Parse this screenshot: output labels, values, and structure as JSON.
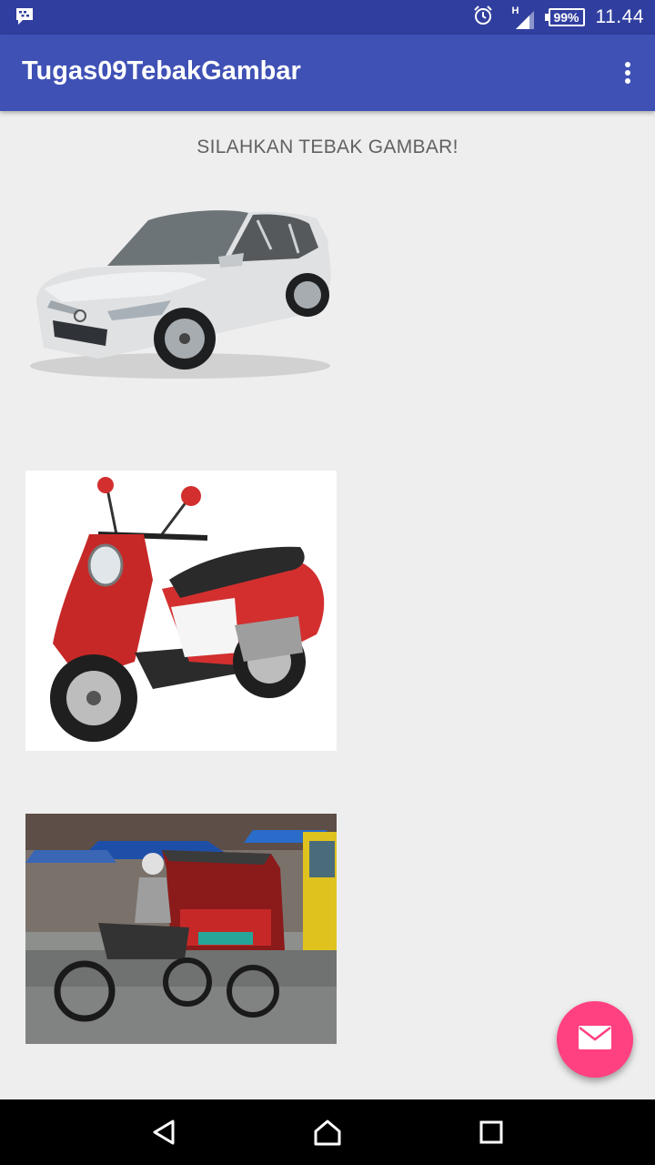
{
  "status_bar": {
    "time": "11.44",
    "battery": "99%",
    "network_label": "H",
    "icons": [
      "bbm-icon",
      "alarm-icon",
      "signal-icon",
      "battery-icon"
    ]
  },
  "app_bar": {
    "title": "Tugas09TebakGambar",
    "overflow_icon": "more-vert-icon"
  },
  "content": {
    "prompt": "SILAHKAN TEBAK GAMBAR!",
    "images": [
      "car-image",
      "scooter-image",
      "becak-image"
    ]
  },
  "fab": {
    "icon": "mail-icon"
  },
  "nav_bar": {
    "icons": [
      "back-icon",
      "home-icon",
      "recents-icon"
    ]
  },
  "colors": {
    "primary": "#3f51b5",
    "primary_dark": "#303f9f",
    "accent": "#ff4081",
    "background": "#eeeeee",
    "prompt_text": "#616161"
  }
}
